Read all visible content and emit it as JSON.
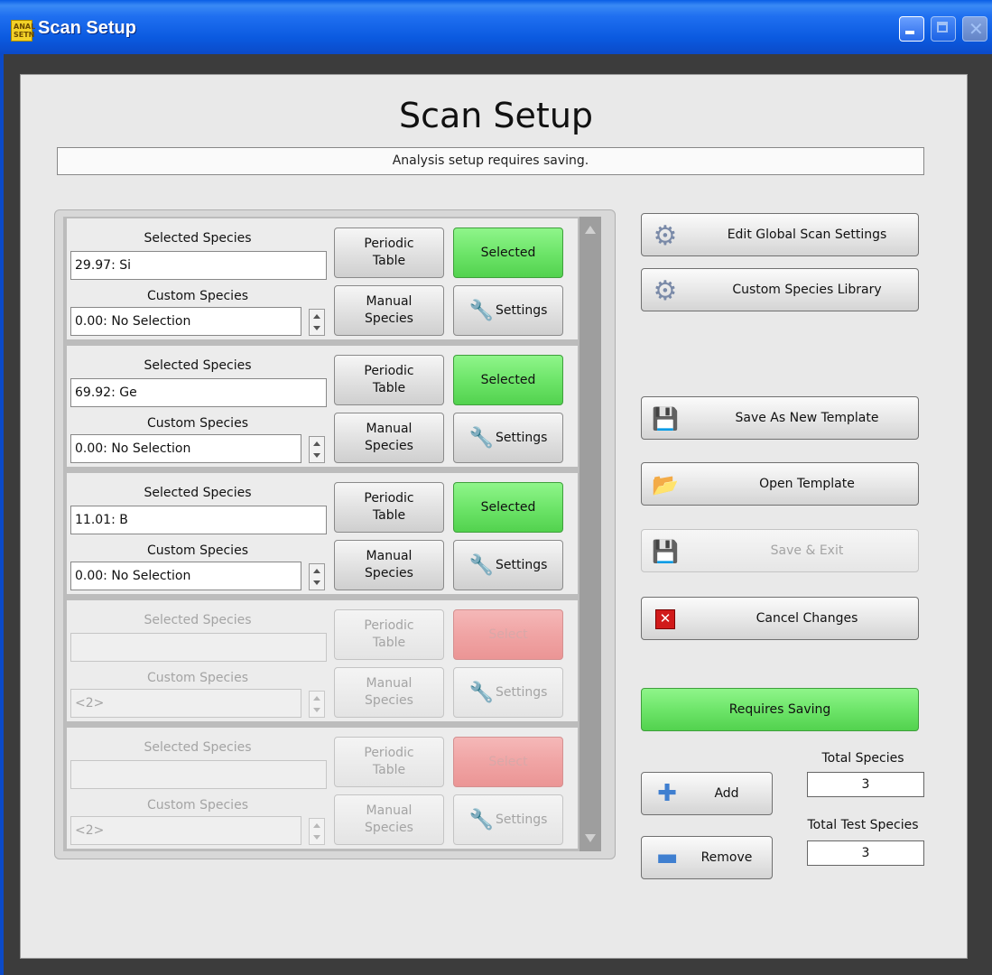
{
  "window": {
    "title": "Scan Setup",
    "app_icon_text": "ANAL SETN"
  },
  "heading": "Scan Setup",
  "status_message": "Analysis setup requires saving.",
  "labels": {
    "selected_species": "Selected Species",
    "custom_species": "Custom Species",
    "periodic_table": "Periodic\nTable",
    "manual_species": "Manual\nSpecies",
    "settings": "Settings"
  },
  "species_rows": [
    {
      "selected_value": "29.97: Si",
      "custom_value": "0.00: No Selection",
      "select_label": "Selected",
      "enabled": true
    },
    {
      "selected_value": "69.92: Ge",
      "custom_value": "0.00: No Selection",
      "select_label": "Selected",
      "enabled": true
    },
    {
      "selected_value": "11.01: B",
      "custom_value": "0.00: No Selection",
      "select_label": "Selected",
      "enabled": true
    },
    {
      "selected_value": "",
      "custom_value": "<2>",
      "select_label": "Select",
      "enabled": false
    },
    {
      "selected_value": "",
      "custom_value": "<2>",
      "select_label": "Select",
      "enabled": false
    }
  ],
  "actions": {
    "edit_global": "Edit  Global Scan Settings",
    "custom_library": "Custom Species Library",
    "save_new_template": "Save As New Template",
    "open_template": "Open Template",
    "save_exit": "Save & Exit",
    "cancel_changes": "Cancel Changes",
    "requires_saving": "Requires Saving",
    "add": "Add",
    "remove": "Remove"
  },
  "counts": {
    "total_species_label": "Total Species",
    "total_species": "3",
    "total_test_species_label": "Total Test Species",
    "total_test_species": "3"
  },
  "colors": {
    "title_bar": "#0b5ae0",
    "selected_green": "#6ee56a",
    "select_pink": "#f0a4a4",
    "cancel_red": "#d11a1a"
  }
}
